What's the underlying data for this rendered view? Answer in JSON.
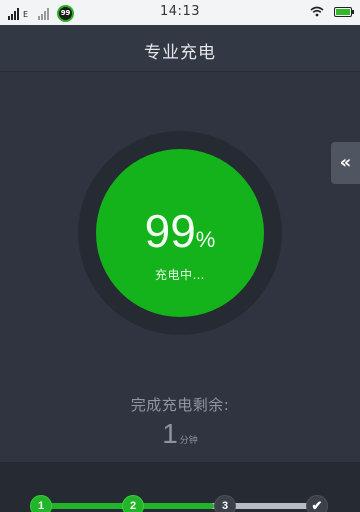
{
  "status_bar": {
    "network_label": "E",
    "battery_circle_value": "99",
    "time": "14:13",
    "icons": [
      "signal-icon",
      "x-signal-icon",
      "wifi-icon",
      "battery-icon"
    ]
  },
  "header": {
    "title": "专业充电"
  },
  "charge": {
    "percent": "99",
    "percent_symbol": "%",
    "status": "充电中…",
    "ring_color": "#14b31c"
  },
  "side_tab": {
    "icon": "double-chevron-left-icon",
    "glyph": "«"
  },
  "remaining": {
    "label": "完成充电剩余:",
    "value": "1",
    "unit": "分钟"
  },
  "steps": {
    "items": [
      {
        "label": "1",
        "state": "done"
      },
      {
        "label": "2",
        "state": "done"
      },
      {
        "label": "3",
        "state": "todo"
      },
      {
        "label": "✔",
        "state": "todo"
      }
    ],
    "accent_color": "#23b529"
  }
}
